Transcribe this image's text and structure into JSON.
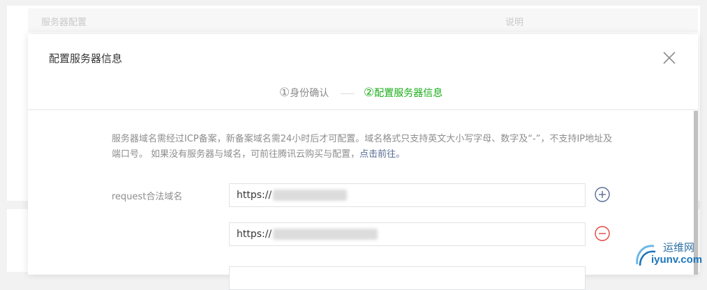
{
  "background": {
    "table_col_config": "服务器配置",
    "table_col_desc": "说明"
  },
  "modal": {
    "title": "配置服务器信息",
    "close_icon": "close-icon",
    "steps": [
      {
        "number": "①",
        "label": "身份确认",
        "state": "done"
      },
      {
        "number": "②",
        "label": "配置服务器信息",
        "state": "active"
      }
    ],
    "notice_text": "服务器域名需经过ICP备案，新备案域名需24小时后才可配置。域名格式只支持英文大小写字母、数字及“-”，不支持IP地址及端口号。 如果没有服务器与域名，可前往腾讯云购买与配置，",
    "notice_link": "点击前往。",
    "field_label": "request合法域名",
    "inputs": [
      {
        "value": "https://"
      },
      {
        "value": "https://"
      },
      {
        "value": ""
      }
    ],
    "add_icon": "plus-circle-icon",
    "remove_icon": "minus-circle-icon"
  },
  "watermark": {
    "cn": "运维网",
    "en": "iyunv.com"
  },
  "colors": {
    "active_step": "#1aad19",
    "link": "#576b95",
    "add": "#576b95",
    "remove": "#e64340"
  }
}
